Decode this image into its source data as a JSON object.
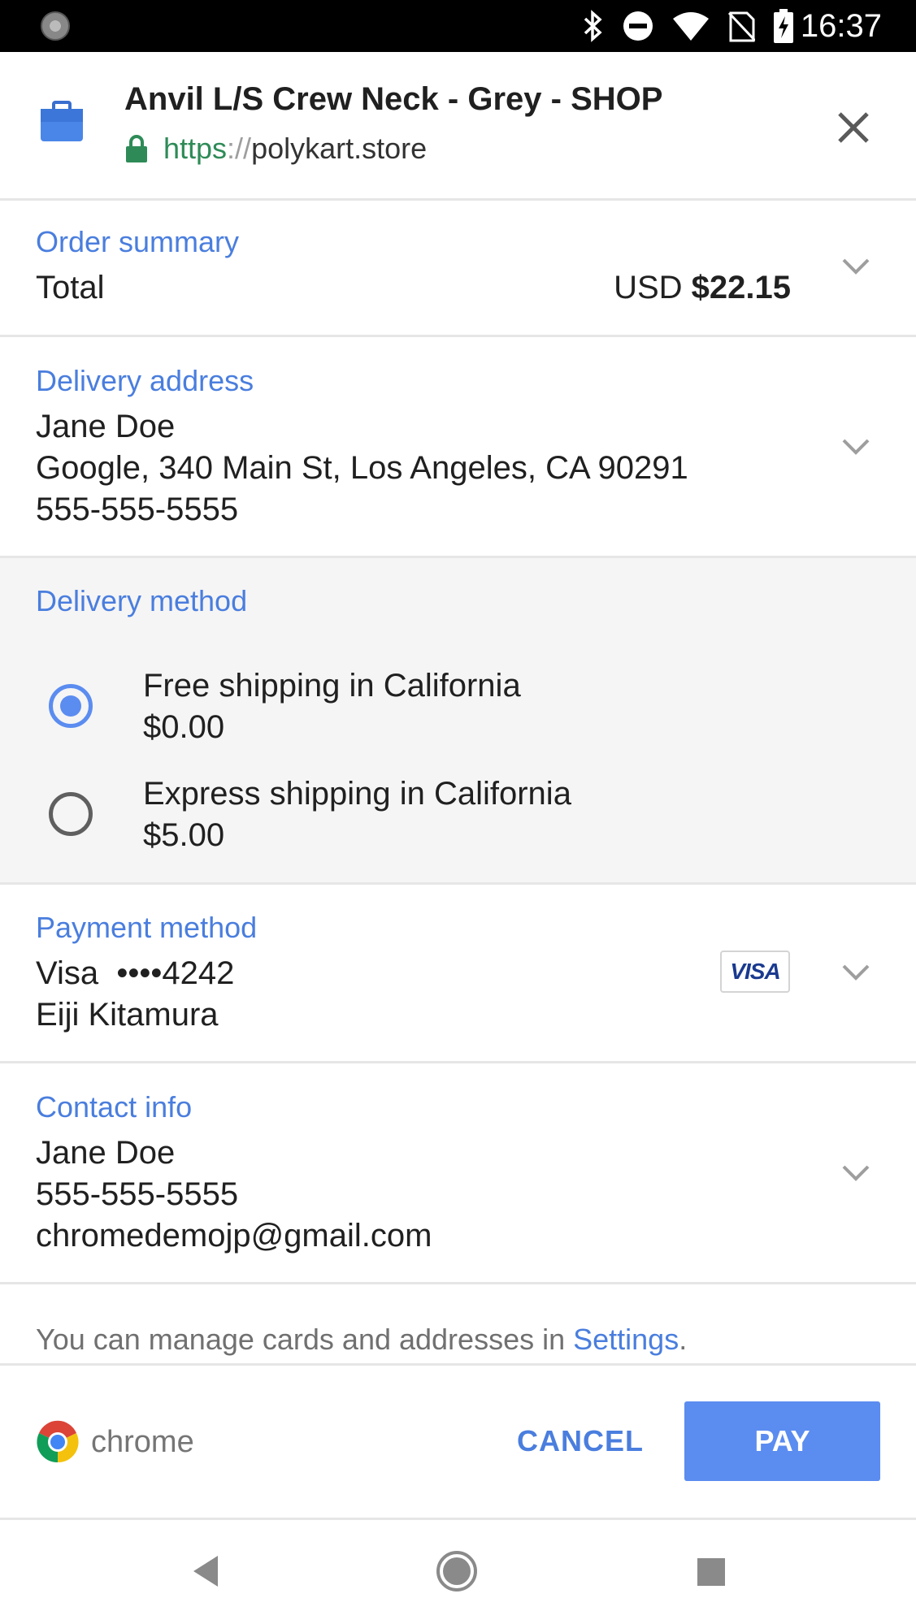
{
  "status_bar": {
    "time": "16:37"
  },
  "header": {
    "title": "Anvil L/S Crew Neck - Grey - SHOP",
    "url_scheme": "https",
    "url_sep": "://",
    "url_host": "polykart.store"
  },
  "order_summary": {
    "label": "Order summary",
    "total_label": "Total",
    "currency": "USD",
    "amount": "$22.15"
  },
  "delivery_address": {
    "label": "Delivery address",
    "name": "Jane Doe",
    "address": "Google, 340 Main St, Los Angeles, CA 90291",
    "phone": "555-555-5555"
  },
  "delivery_method": {
    "label": "Delivery method",
    "options": [
      {
        "name": "Free shipping in California",
        "price": "$0.00",
        "selected": true
      },
      {
        "name": "Express shipping in California",
        "price": "$5.00",
        "selected": false
      }
    ]
  },
  "payment_method": {
    "label": "Payment method",
    "card": "Visa  ••••4242",
    "holder": "Eiji Kitamura",
    "card_brand": "VISA"
  },
  "contact_info": {
    "label": "Contact info",
    "name": "Jane Doe",
    "phone": "555-555-5555",
    "email": "chromedemojp@gmail.com"
  },
  "footer": {
    "note": "You can manage cards and addresses in ",
    "settings_link": "Settings",
    "period": ".",
    "brand": "chrome",
    "cancel_label": "CANCEL",
    "pay_label": "PAY"
  },
  "colors": {
    "accent": "#5b8cf0",
    "label_blue": "#4a7ede",
    "url_green": "#2e8b57",
    "section_gray": "#f5f5f5"
  }
}
